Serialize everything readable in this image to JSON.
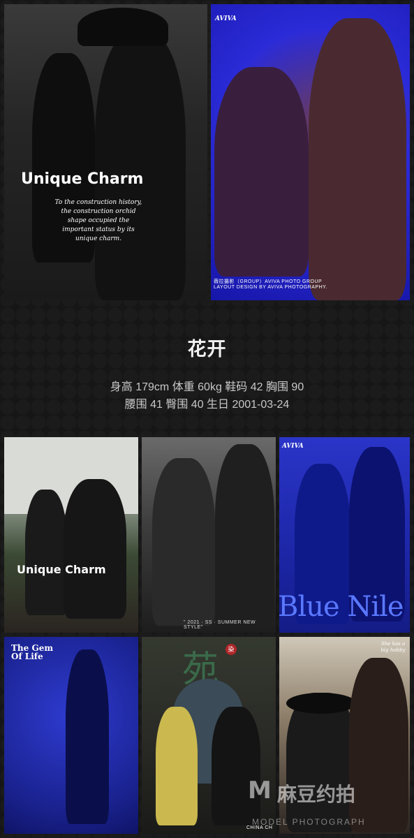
{
  "hero_photos": [
    {
      "overlay_title": "Unique Charm",
      "overlay_script": "To the construction history, the construction orchid shape occupied the important status by its unique charm."
    },
    {
      "logo": "AVIVA",
      "caption_line1": "薇拉摄影（GROUP）AVIVA PHOTO GROUP",
      "caption_line2": "LAYOUT DESIGN BY AVIVA PHOTOGRAPHY."
    }
  ],
  "artist": {
    "name": "花开",
    "stats_line1": "身高 179cm   体重 60kg   鞋码 42   胸围 90",
    "stats_line2": "腰围 41   臀围 40   生日 2001-03-24"
  },
  "gallery": [
    {
      "overlay": "Unique Charm"
    },
    {
      "caption": "\" 2021 · SS · SUMMER NEW STYLE\""
    },
    {
      "logo": "AVIVA",
      "overlay": "Blue Nile"
    },
    {
      "title_line1": "The Gem",
      "title_line2": "Of Life"
    },
    {
      "big_char": "苑",
      "seal_char": "染",
      "caption": "CHINA CH"
    },
    {
      "script": "She has a big hobby"
    }
  ],
  "watermark": {
    "mark": "M",
    "chinese": "麻豆约拍",
    "english": "MODEL PHOTOGRAPH"
  },
  "colors": {
    "background": "#161616",
    "accent_blue": "#2b2bd8",
    "text": "#ffffff",
    "muted_text": "#c8c8c8"
  }
}
